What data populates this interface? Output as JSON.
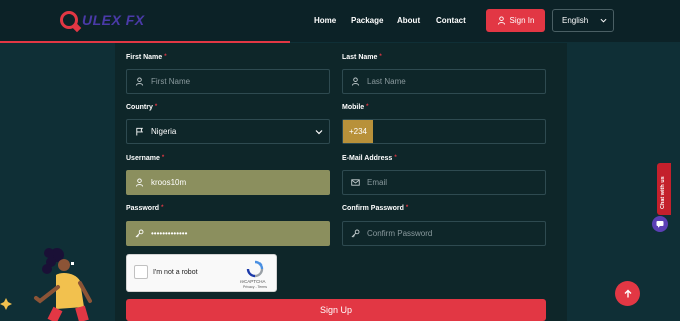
{
  "header": {
    "logo_text": "ULEX FX",
    "nav": {
      "home": "Home",
      "package": "Package",
      "about": "About",
      "contact": "Contact"
    },
    "signin_label": "Sign In",
    "language": "English"
  },
  "form": {
    "first_name": {
      "label": "First Name",
      "required": "*",
      "placeholder": "First Name",
      "value": ""
    },
    "last_name": {
      "label": "Last Name",
      "required": "*",
      "placeholder": "Last Name",
      "value": ""
    },
    "country": {
      "label": "Country",
      "required": "*",
      "value": "Nigeria"
    },
    "mobile": {
      "label": "Mobile",
      "required": "*",
      "prefix": "+234",
      "value": ""
    },
    "username": {
      "label": "Username",
      "required": "*",
      "value": "kroos10m"
    },
    "email": {
      "label": "E-Mail Address",
      "required": "*",
      "placeholder": "Email",
      "value": ""
    },
    "password": {
      "label": "Password",
      "required": "*",
      "value": "•••••••••••••"
    },
    "confirm_password": {
      "label": "Confirm Password",
      "required": "*",
      "placeholder": "Confirm Password",
      "value": ""
    },
    "captcha": {
      "label": "I'm not a robot",
      "brand": "reCAPTCHA",
      "terms": "Privacy - Terms"
    },
    "submit_label": "Sign Up"
  },
  "widgets": {
    "chat_tab_label": "Chat with us"
  },
  "colors": {
    "accent": "#e23744",
    "background": "#0f2f36",
    "autofill": "#8b8f5e",
    "prefix": "#b8913a"
  }
}
